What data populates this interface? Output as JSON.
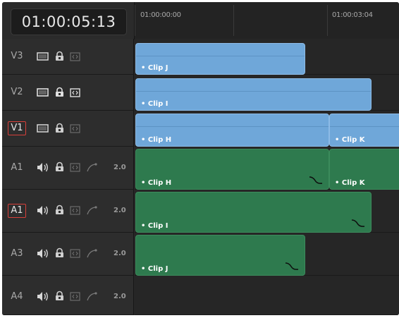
{
  "timeline": {
    "timecode": "01:00:05:13",
    "ruler": [
      "01:00:00:00",
      "01:00:03:04"
    ]
  },
  "tracks": [
    {
      "name": "V3",
      "kind": "video",
      "active": false
    },
    {
      "name": "V2",
      "kind": "video",
      "active": false
    },
    {
      "name": "V1",
      "kind": "video",
      "active": true
    },
    {
      "name": "A1",
      "kind": "audio",
      "active": false,
      "channels": "2.0"
    },
    {
      "name": "A1",
      "kind": "audio",
      "active": true,
      "channels": "2.0"
    },
    {
      "name": "A3",
      "kind": "audio",
      "active": false,
      "channels": "2.0"
    },
    {
      "name": "A4",
      "kind": "audio",
      "active": false,
      "channels": "2.0"
    }
  ],
  "clips": [
    {
      "track": "V3",
      "label": "• Clip J",
      "kind": "video"
    },
    {
      "track": "V2",
      "label": "• Clip I",
      "kind": "video"
    },
    {
      "track": "V1",
      "label": "• Clip H",
      "kind": "video"
    },
    {
      "track": "V1",
      "label": "• Clip K",
      "kind": "video"
    },
    {
      "track": "A1",
      "label": "• Clip H",
      "kind": "audio"
    },
    {
      "track": "A1",
      "label": "• Clip K",
      "kind": "audio"
    },
    {
      "track": "A1",
      "label": "• Clip I",
      "kind": "audio"
    },
    {
      "track": "A3",
      "label": "• Clip J",
      "kind": "audio"
    }
  ],
  "icons": {
    "video_track": [
      "monitor-icon",
      "lock-icon",
      "auto-select-icon"
    ],
    "audio_track": [
      "speaker-icon",
      "lock-icon",
      "auto-select-icon",
      "curve-icon"
    ]
  },
  "colors": {
    "video_clip": "#6fa7d9",
    "audio_clip": "#2e7a4e",
    "active_track_outline": "#d8403a"
  }
}
